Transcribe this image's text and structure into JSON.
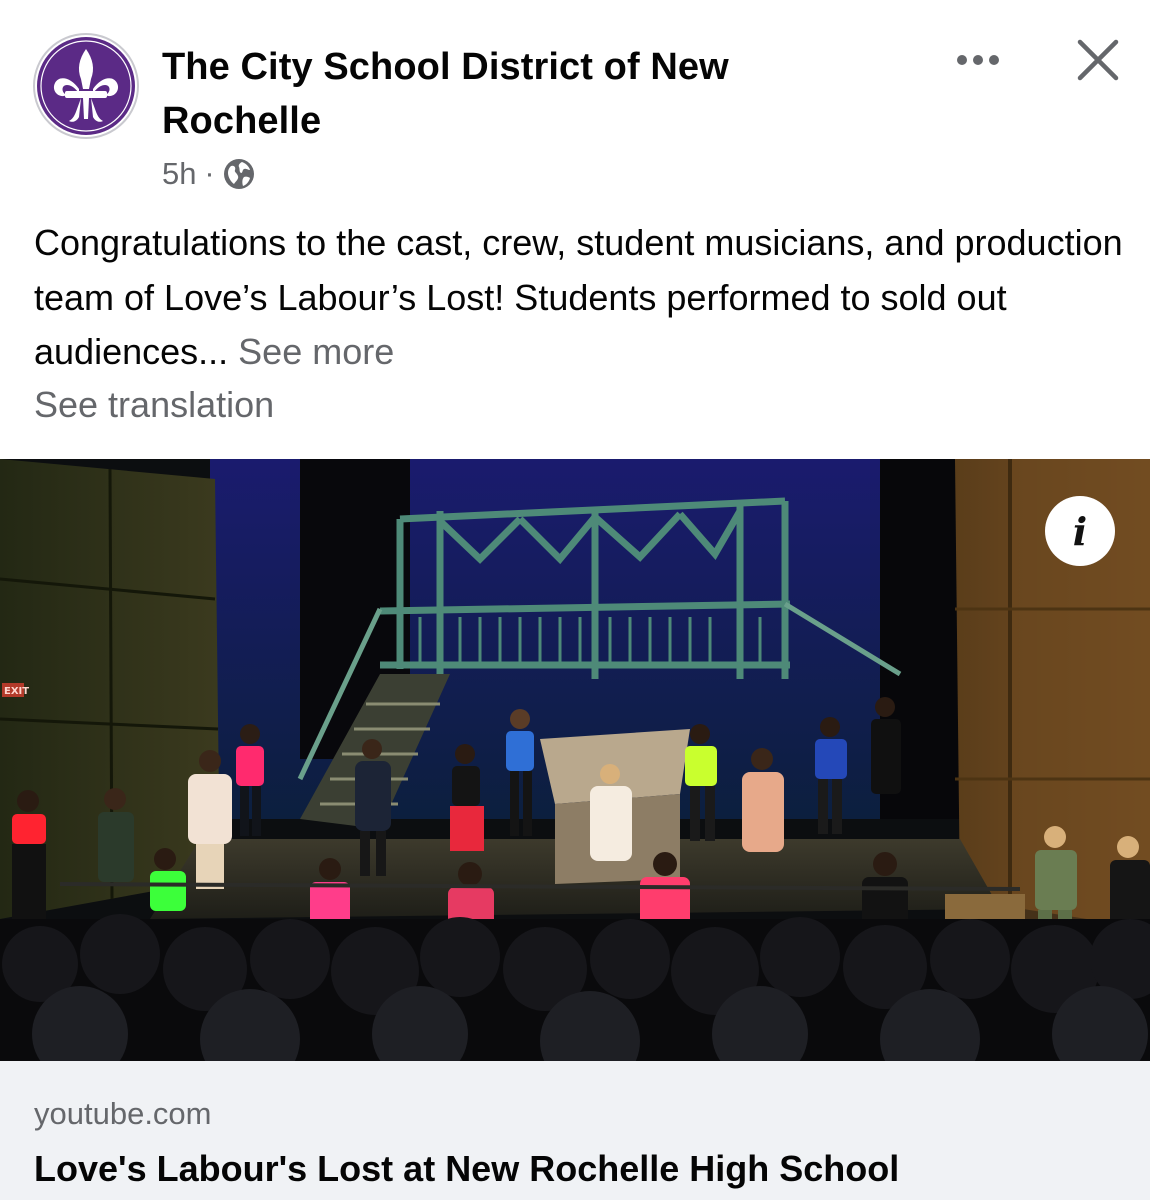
{
  "post": {
    "page_name": "The City School District of New Rochelle",
    "time": "5h",
    "separator": "·",
    "privacy_icon": "globe-icon",
    "text_body": "Congratulations to the cast, crew, student musicians, and production team of Love’s Labour’s Lost! Students performed to sold out audiences...",
    "see_more": "See more",
    "see_translation": "See translation",
    "avatar_icon": "fleur-de-lis-icon",
    "accent_color": "#5b2a86"
  },
  "actions": {
    "more_icon": "more-icon",
    "close_icon": "close-icon"
  },
  "media": {
    "type": "video-thumbnail",
    "info_label": "i",
    "exit_sign": "EXIT"
  },
  "link_preview": {
    "domain": "youtube.com",
    "title": "Love's Labour's Lost at New Rochelle High School"
  }
}
